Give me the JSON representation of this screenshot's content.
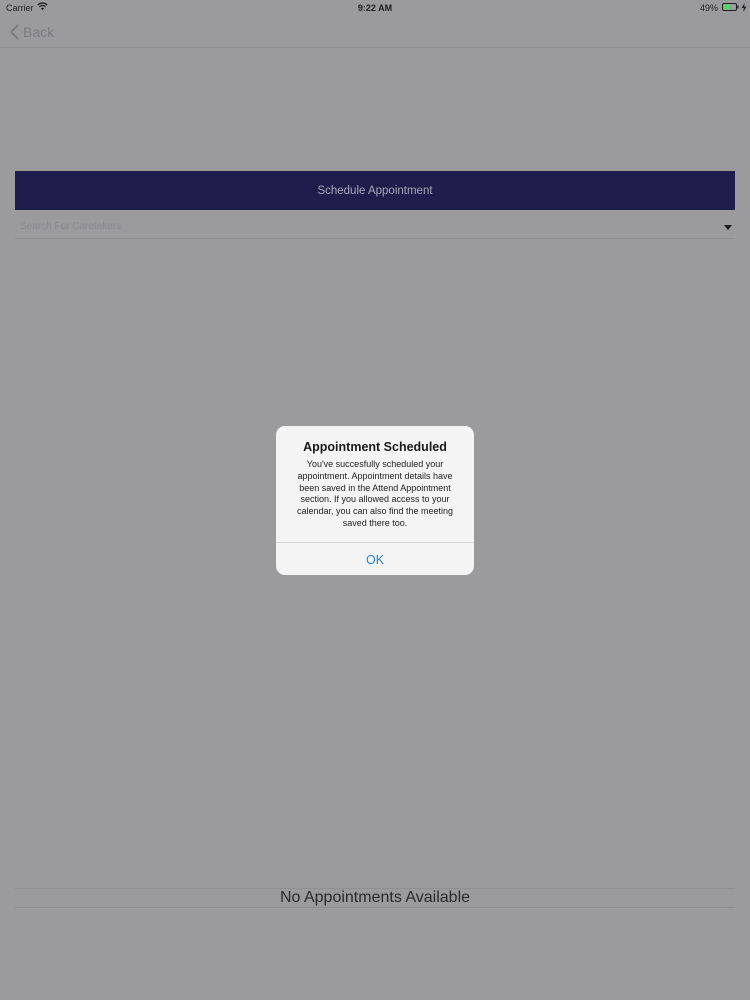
{
  "status_bar": {
    "carrier": "Carrier",
    "time": "9:22 AM",
    "battery_percent": "49%",
    "battery_level": 0.49,
    "battery_color": "#4cd964"
  },
  "nav": {
    "back_label": "Back"
  },
  "schedule": {
    "header_label": "Schedule Appointment",
    "header_color": "#1f1d4c",
    "search_placeholder": "Search For Caretakers"
  },
  "alert": {
    "title": "Appointment Scheduled",
    "message": "You've succesfully scheduled your appointment.  Appointment details have been saved in the Attend Appointment section.  If you allowed access to your calendar, you can also find the meeting saved there too.",
    "ok_label": "OK",
    "ok_color": "#2a83c9"
  },
  "appointments": {
    "empty_message": "No Appointments Available"
  }
}
